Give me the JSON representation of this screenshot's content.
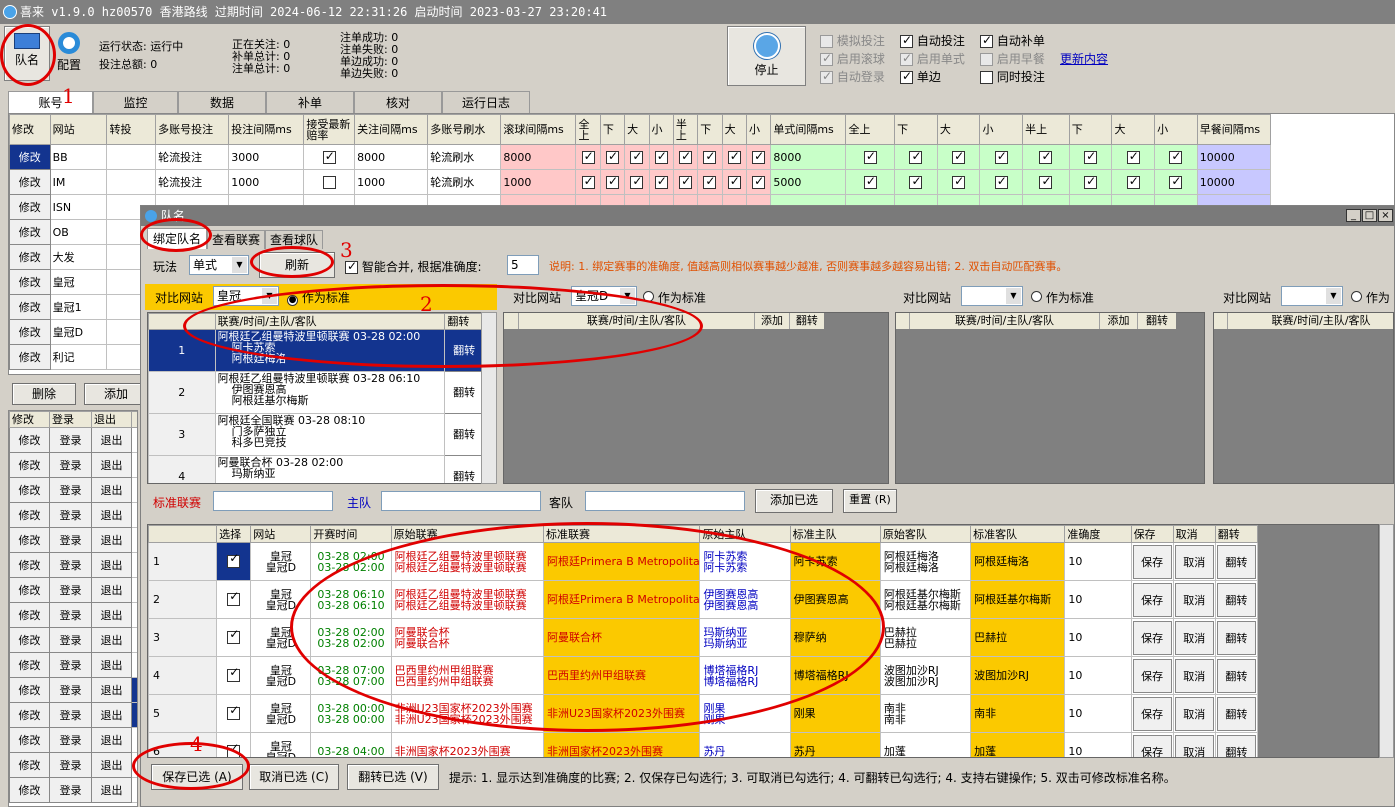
{
  "titlebar": {
    "text": "喜来 v1.9.0 hz00570 香港路线 过期时间 2024-06-12 22:31:26 启动时间 2023-03-27 23:20:41"
  },
  "toolbar": {
    "team_btn": "队名",
    "config_btn": "配置",
    "stop_btn": "停止",
    "status": {
      "run_state": "运行状态: 运行中",
      "bet_total": "投注总额: 0",
      "watching": "正在关注: 0",
      "supplement_total": "补单总计: 0",
      "order_total": "注单总计: 0",
      "order_success": "注单成功: 0",
      "order_fail": "注单失败: 0",
      "single_success": "单边成功: 0",
      "single_fail": "单边失败: 0"
    },
    "options": {
      "sim_bet": "模拟投注",
      "auto_bet": "自动投注",
      "auto_supp": "自动补单",
      "enable_roll": "启用滚球",
      "enable_single": "启用单式",
      "enable_early": "启用早餐",
      "auto_login": "自动登录",
      "single_side": "单边",
      "sync_bet": "同时投注",
      "update_link": "更新内容"
    }
  },
  "main_tabs": [
    "账号",
    "监控",
    "数据",
    "补单",
    "核对",
    "运行日志"
  ],
  "account_grid": {
    "headers": [
      "修改",
      "网站",
      "转投",
      "多账号投注",
      "投注间隔ms",
      "接受最新赔率",
      "关注间隔ms",
      "多账号刷水",
      "滚球间隔ms",
      "全上",
      "下",
      "大",
      "小",
      "半上",
      "下",
      "大",
      "小",
      "单式间隔ms",
      "全上",
      "下",
      "大",
      "小",
      "半上",
      "下",
      "大",
      "小",
      "早餐间隔ms"
    ],
    "rows": [
      {
        "edit": "修改",
        "site": "BB",
        "mode": "轮流投注",
        "bet_ms": "3000",
        "follow_ms": "8000",
        "refresh": "轮流刷水",
        "roll_ms": "8000",
        "single_ms": "8000",
        "early_ms": "10000"
      },
      {
        "edit": "修改",
        "site": "IM",
        "mode": "轮流投注",
        "bet_ms": "1000",
        "follow_ms": "1000",
        "refresh": "轮流刷水",
        "roll_ms": "1000",
        "single_ms": "5000",
        "early_ms": "10000"
      },
      {
        "edit": "修改",
        "site": "ISN"
      },
      {
        "edit": "修改",
        "site": "OB"
      },
      {
        "edit": "修改",
        "site": "大发"
      },
      {
        "edit": "修改",
        "site": "皇冠"
      },
      {
        "edit": "修改",
        "site": "皇冠1"
      },
      {
        "edit": "修改",
        "site": "皇冠D"
      },
      {
        "edit": "修改",
        "site": "利记"
      }
    ]
  },
  "left_buttons": {
    "delete": "删除",
    "add": "添加"
  },
  "login_grid": {
    "headers": [
      "修改",
      "登录",
      "退出"
    ],
    "edit": "修改",
    "login": "登录",
    "logout": "退出",
    "row_count": 15
  },
  "dialog": {
    "title": "队名",
    "tabs": [
      "绑定队名",
      "查看联赛",
      "查看球队"
    ],
    "play_label": "玩法",
    "play_value": "单式",
    "refresh_btn": "刷新",
    "smart_merge": "智能合并, 根据准确度:",
    "accuracy": "5",
    "note": "说明: 1. 绑定赛事的准确度, 值越高则相似赛事越少越准, 否则赛事越多越容易出错; 2. 双击自动匹配赛事。",
    "compare_site_label": "对比网站",
    "as_standard": "作为标准",
    "panels": [
      {
        "site": "皇冠",
        "header": "联赛/时间/主队/客队",
        "flip": "翻转"
      },
      {
        "site": "皇冠D",
        "header": "联赛/时间/主队/客队",
        "add": "添加",
        "flip": "翻转"
      },
      {
        "site": "",
        "header": "联赛/时间/主队/客队",
        "add": "添加",
        "flip": "翻转"
      },
      {
        "site": "",
        "header": "联赛/时间/主队/客队",
        "label_partial": "作为"
      }
    ],
    "match_list": [
      {
        "n": "1",
        "league": "阿根廷乙组曼特波里顿联赛 03-28 02:00",
        "home": "阿卡苏索",
        "away": "阿根廷梅洛",
        "flip": "翻转"
      },
      {
        "n": "2",
        "league": "阿根廷乙组曼特波里顿联赛 03-28 06:10",
        "home": "伊图赛恩高",
        "away": "阿根廷基尔梅斯",
        "flip": "翻转"
      },
      {
        "n": "3",
        "league": "阿根廷全国联赛 03-28 08:10",
        "home": "门多萨独立",
        "away": "科多巴竞技",
        "flip": "翻转"
      },
      {
        "n": "4",
        "league": "阿曼联合杯 03-28 02:00",
        "home": "玛斯纳亚",
        "away": "",
        "flip": "翻转"
      }
    ],
    "std_league_label": "标准联赛",
    "home_label": "主队",
    "away_label": "客队",
    "add_selected_btn": "添加已选",
    "reset_btn": "重置 (R)",
    "bind_headers": [
      "选择",
      "网站",
      "开赛时间",
      "原始联赛",
      "标准联赛",
      "原始主队",
      "标准主队",
      "原始客队",
      "标准客队",
      "准确度",
      "保存",
      "取消",
      "翻转"
    ],
    "bind_rows": [
      {
        "n": "1",
        "site1": "皇冠",
        "site2": "皇冠D",
        "t1": "03-28 02:00",
        "t2": "03-28 02:00",
        "ol1": "阿根廷乙组曼特波里顿联赛",
        "ol2": "阿根廷乙组曼特波里顿联赛",
        "sl": "阿根廷Primera B Metropolitana",
        "oh1": "阿卡苏索",
        "oh2": "阿卡苏索",
        "sh": "阿卡苏索",
        "oa1": "阿根廷梅洛",
        "oa2": "阿根廷梅洛",
        "sa": "阿根廷梅洛",
        "acc": "10"
      },
      {
        "n": "2",
        "site1": "皇冠",
        "site2": "皇冠D",
        "t1": "03-28 06:10",
        "t2": "03-28 06:10",
        "ol1": "阿根廷乙组曼特波里顿联赛",
        "ol2": "阿根廷乙组曼特波里顿联赛",
        "sl": "阿根廷Primera B Metropolitana",
        "oh1": "伊图赛恩高",
        "oh2": "伊图赛恩高",
        "sh": "伊图赛恩高",
        "oa1": "阿根廷基尔梅斯",
        "oa2": "阿根廷基尔梅斯",
        "sa": "阿根廷基尔梅斯",
        "acc": "10"
      },
      {
        "n": "3",
        "site1": "皇冠",
        "site2": "皇冠D",
        "t1": "03-28 02:00",
        "t2": "03-28 02:00",
        "ol1": "阿曼联合杯",
        "ol2": "阿曼联合杯",
        "sl": "阿曼联合杯",
        "oh1": "玛斯纳亚",
        "oh2": "玛斯纳亚",
        "sh": "穆萨纳",
        "oa1": "巴赫拉",
        "oa2": "巴赫拉",
        "sa": "巴赫拉",
        "acc": "10"
      },
      {
        "n": "4",
        "site1": "皇冠",
        "site2": "皇冠D",
        "t1": "03-28 07:00",
        "t2": "03-28 07:00",
        "ol1": "巴西里约州甲组联赛",
        "ol2": "巴西里约州甲组联赛",
        "sl": "巴西里约州甲组联赛",
        "oh1": "博塔福格RJ",
        "oh2": "博塔福格RJ",
        "sh": "博塔福格RJ",
        "oa1": "波图加沙RJ",
        "oa2": "波图加沙RJ",
        "sa": "波图加沙RJ",
        "acc": "10"
      },
      {
        "n": "5",
        "site1": "皇冠",
        "site2": "皇冠D",
        "t1": "03-28 00:00",
        "t2": "03-28 00:00",
        "ol1": "非洲U23国家杯2023外围赛",
        "ol2": "非洲U23国家杯2023外围赛",
        "sl": "非洲U23国家杯2023外围赛",
        "oh1": "刚果",
        "oh2": "刚果",
        "sh": "刚果",
        "oa1": "南非",
        "oa2": "南非",
        "sa": "南非",
        "acc": "10"
      },
      {
        "n": "6",
        "site1": "皇冠",
        "site2": "皇冠D",
        "t1": "03-28 04:00",
        "t2": "",
        "ol1": "非洲国家杯2023外围赛",
        "ol2": "",
        "sl": "非洲国家杯2023外围赛",
        "oh1": "苏丹",
        "oh2": "",
        "sh": "苏丹",
        "oa1": "加蓬",
        "oa2": "",
        "sa": "加蓬",
        "acc": "10"
      }
    ],
    "row_btns": {
      "save": "保存",
      "cancel": "取消",
      "flip": "翻转"
    },
    "bottom": {
      "save_sel": "保存已选 (A)",
      "cancel_sel": "取消已选 (C)",
      "flip_sel": "翻转已选 (V)",
      "tips": "提示: 1. 显示达到准确度的比赛; 2. 仅保存已勾选行; 3. 可取消已勾选行; 4. 可翻转已勾选行; 4. 支持右键操作; 5. 双击可修改标准名称。"
    }
  },
  "annotations": [
    "1",
    "2",
    "3",
    "4"
  ],
  "colors": {
    "selection": "#13348f",
    "highlight_yellow": "#fbc900",
    "annotation_red": "#e00000",
    "pink": "#ffc8c8",
    "green": "#c8ffc8",
    "lavender": "#c8c8ff"
  }
}
